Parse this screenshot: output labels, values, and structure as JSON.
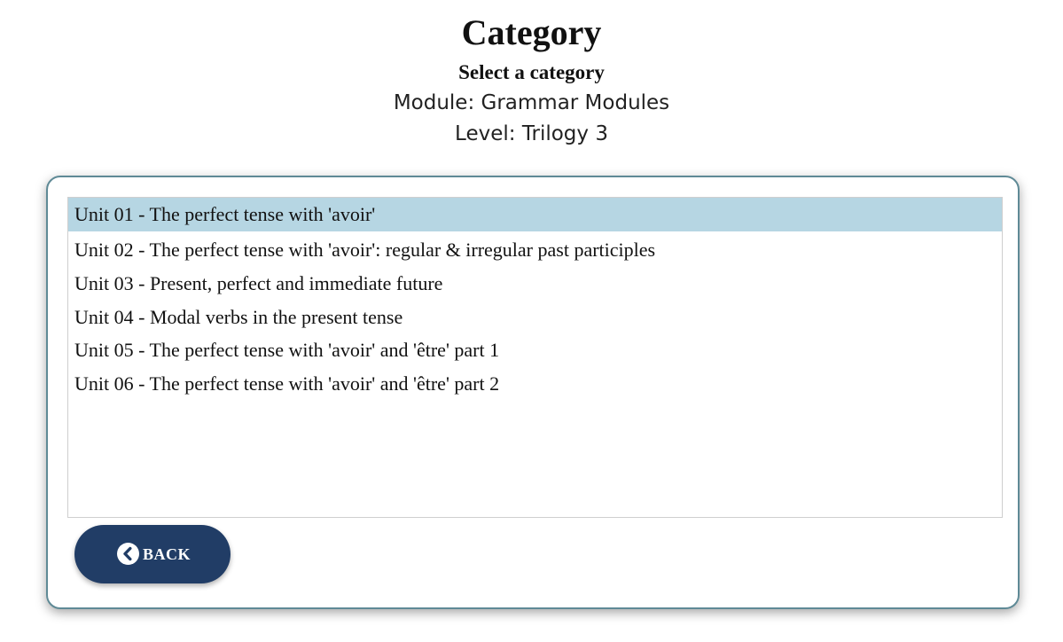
{
  "header": {
    "title": "Category",
    "subtitle": "Select a category",
    "module": "Module: Grammar Modules",
    "level": "Level: Trilogy 3"
  },
  "categories": {
    "selected_index": 0,
    "items": [
      "Unit 01 - The perfect tense with 'avoir'",
      "Unit 02 - The perfect tense with 'avoir': regular & irregular past participles",
      "Unit 03 - Present, perfect and immediate future",
      "Unit 04 - Modal verbs in the present tense",
      "Unit 05 - The perfect tense with 'avoir' and 'être' part 1",
      "Unit 06 - The perfect tense with 'avoir' and 'être' part 2"
    ]
  },
  "back_button": {
    "label": "BACK",
    "icon": "chevron-left-circle-icon"
  },
  "colors": {
    "selected_row": "#b6d6e3",
    "panel_border": "#5f8a96",
    "button_background": "#213d66"
  }
}
